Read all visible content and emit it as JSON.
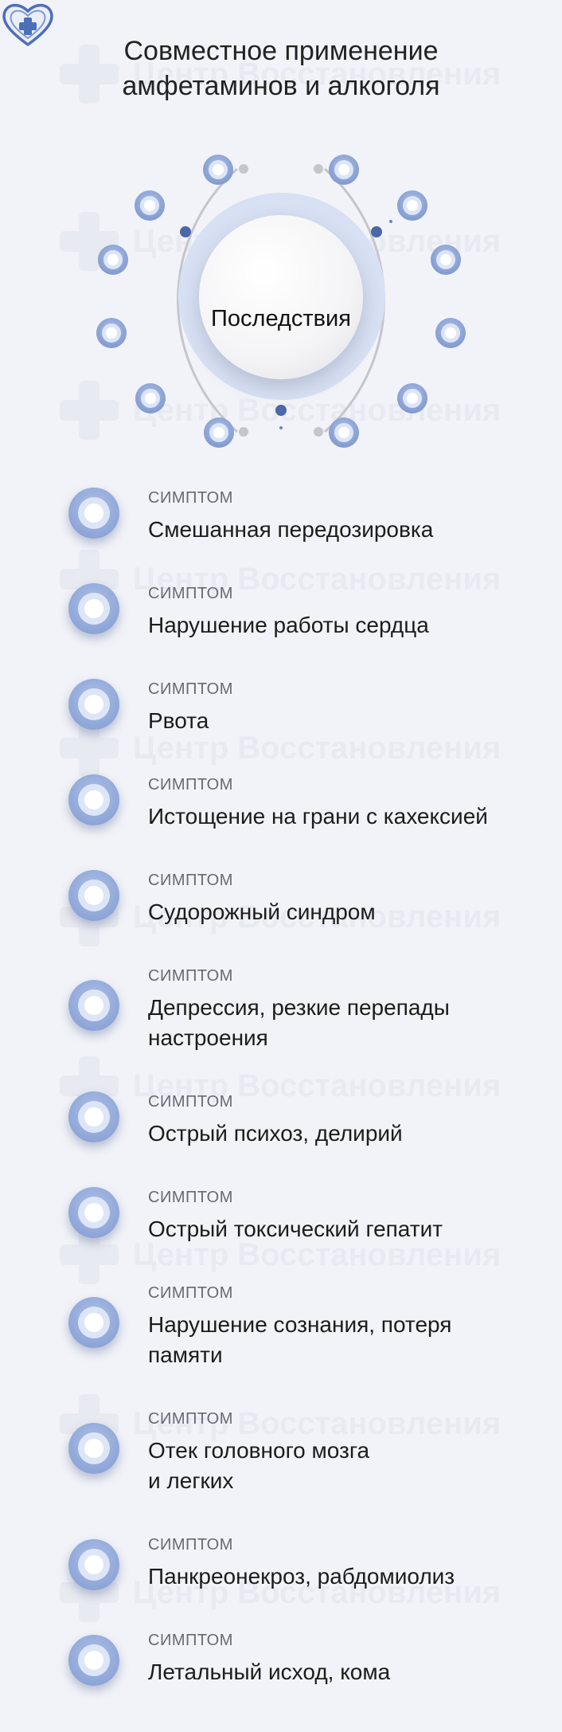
{
  "title": {
    "line1": "Совместное применение",
    "line2": "амфетаминов и алкоголя"
  },
  "diagram": {
    "center_label": "Последствия",
    "center_icon": "heart-cross-icon",
    "accent_color": "#8ea6d8",
    "ring_color": "#c4c6cc"
  },
  "watermark": {
    "text": "Центр Восстановления"
  },
  "items": [
    {
      "tag": "СИМПТОМ",
      "line1": "Смешанная передозировка",
      "line2": ""
    },
    {
      "tag": "СИМПТОМ",
      "line1": "Нарушение работы сердца",
      "line2": ""
    },
    {
      "tag": "СИМПТОМ",
      "line1": "Рвота",
      "line2": ""
    },
    {
      "tag": "СИМПТОМ",
      "line1": "Истощение на грани с кахексией",
      "line2": ""
    },
    {
      "tag": "СИМПТОМ",
      "line1": "Судорожный синдром",
      "line2": ""
    },
    {
      "tag": "СИМПТОМ",
      "line1": "Депрессия, резкие перепады",
      "line2": "настроения"
    },
    {
      "tag": "СИМПТОМ",
      "line1": "Острый психоз, делирий",
      "line2": ""
    },
    {
      "tag": "СИМПТОМ",
      "line1": "Острый токсический гепатит",
      "line2": ""
    },
    {
      "tag": "СИМПТОМ",
      "line1": "Нарушение сознания, потеря",
      "line2": "памяти"
    },
    {
      "tag": "СИМПТОМ",
      "line1": "Отек головного мозга",
      "line2": "и легких"
    },
    {
      "tag": "СИМПТОМ",
      "line1": "Панкреонекроз, рабдомиолиз",
      "line2": ""
    },
    {
      "tag": "СИМПТОМ",
      "line1": "Летальный исход,  кома",
      "line2": ""
    }
  ]
}
